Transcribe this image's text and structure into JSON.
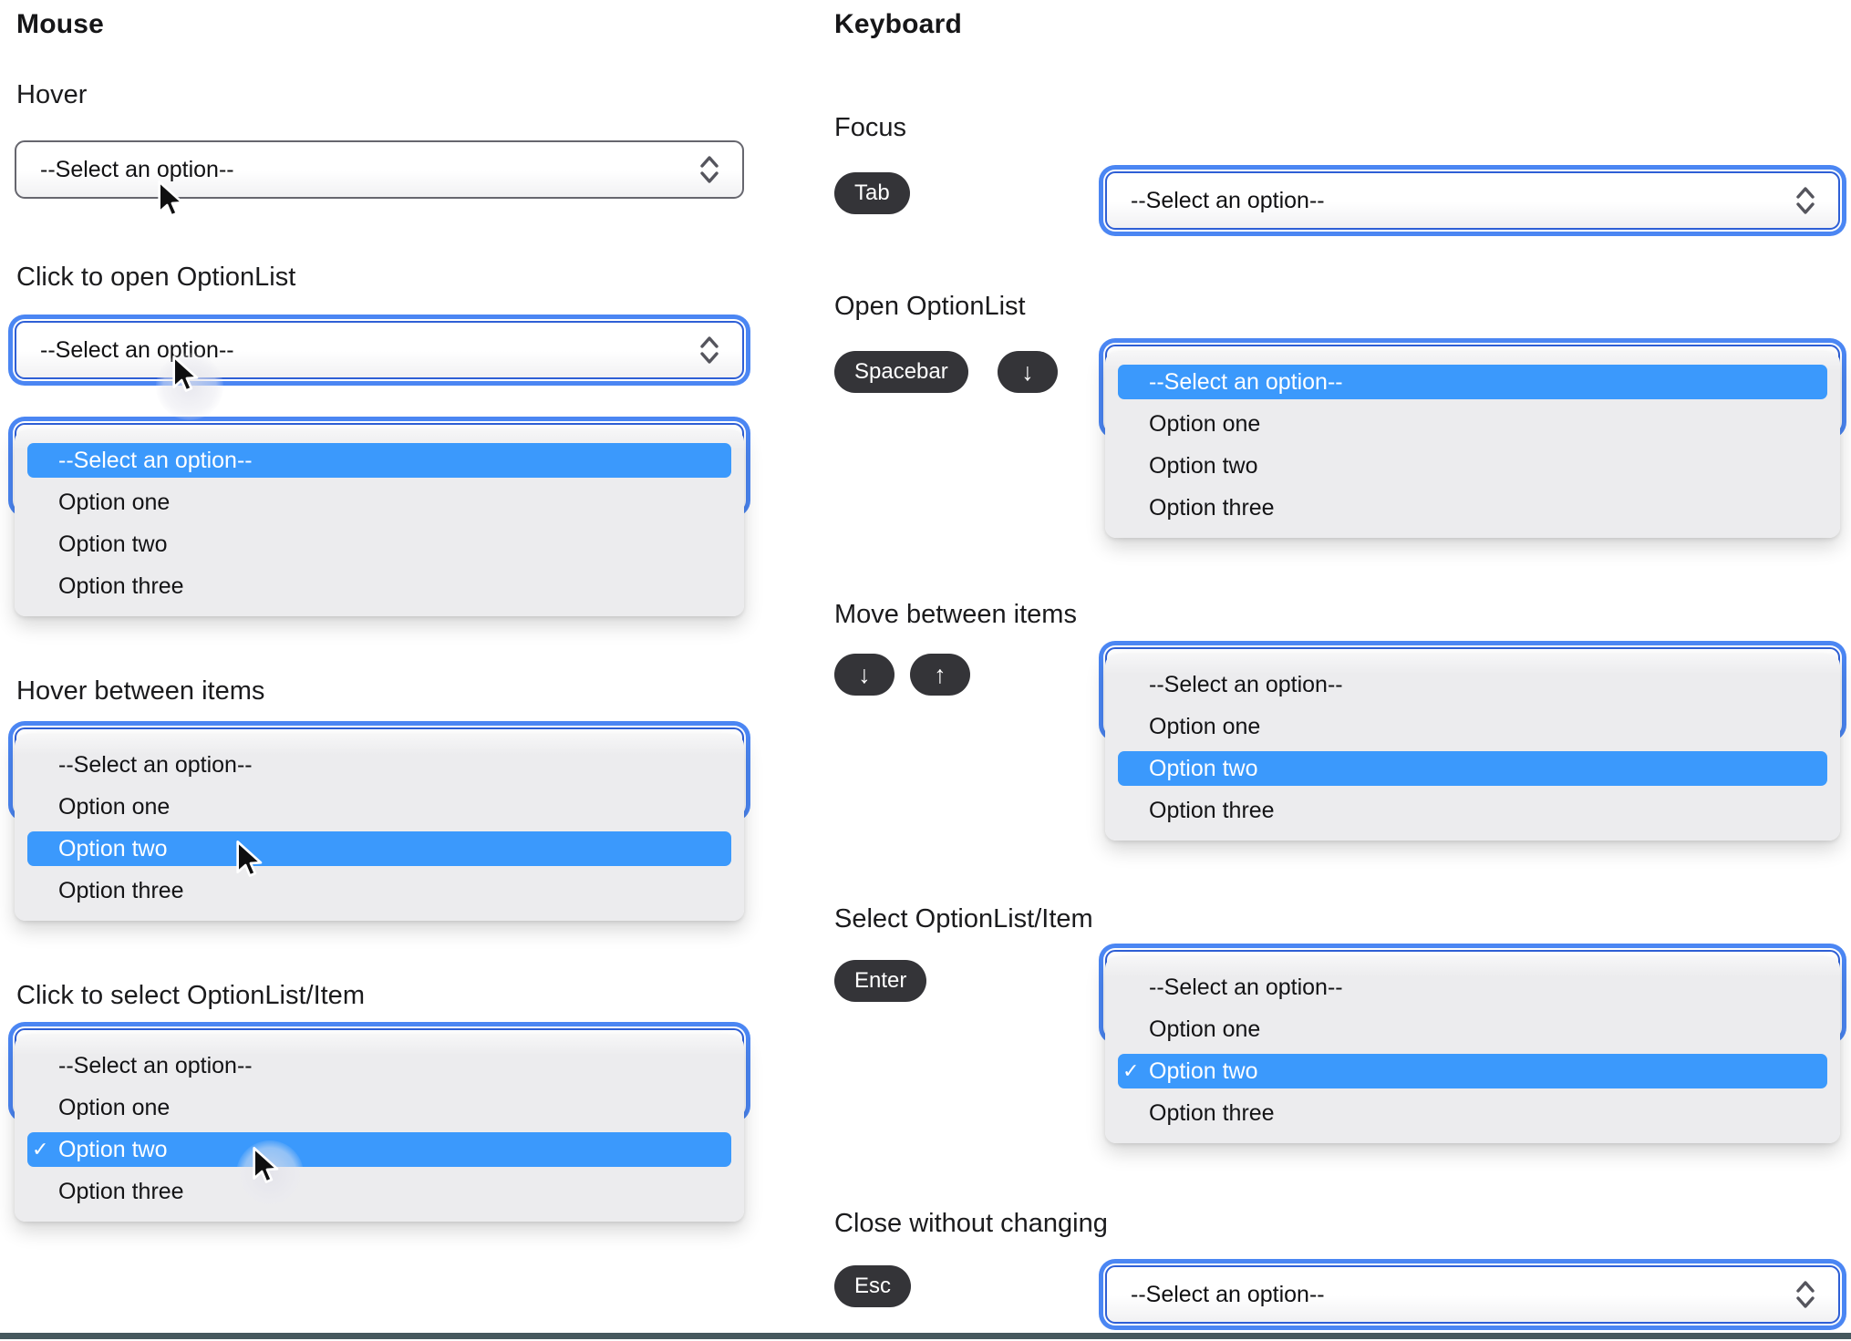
{
  "mouse": {
    "title": "Mouse",
    "sections": {
      "hover": {
        "label": "Hover"
      },
      "click_open": {
        "label": "Click to open OptionList"
      },
      "hover_between": {
        "label": "Hover between items"
      },
      "click_select": {
        "label": "Click to select OptionList/Item"
      }
    }
  },
  "keyboard": {
    "title": "Keyboard",
    "sections": {
      "focus": {
        "label": "Focus",
        "key": "Tab"
      },
      "open": {
        "label": "Open OptionList",
        "keys": [
          "Spacebar",
          "↓"
        ]
      },
      "move": {
        "label": "Move between items",
        "keys": [
          "↓",
          "↑"
        ]
      },
      "select_item": {
        "label": "Select OptionList/Item",
        "key": "Enter"
      },
      "close": {
        "label": "Close without changing",
        "key": "Esc"
      }
    }
  },
  "optionlist": {
    "placeholder": "--Select an option--",
    "options": [
      "Option one",
      "Option two",
      "Option three"
    ],
    "checkmark": "✓",
    "selected_option": "Option two",
    "highlight_color": "#3b99fc",
    "focus_ring_color": "#4b86f3",
    "focus_border_color": "#2e5fd6",
    "key_badge_color": "#343438",
    "panel_color": "#ececee",
    "divider_color": "#46585e"
  }
}
